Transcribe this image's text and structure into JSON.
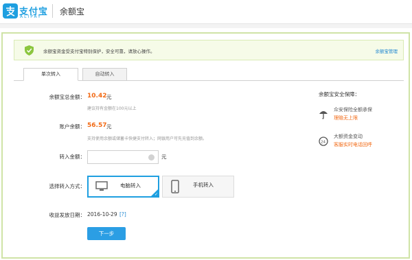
{
  "header": {
    "logo_cn": "支付宝",
    "logo_en": "ALIPAY",
    "product_title": "余额宝"
  },
  "notice": {
    "text": "余额宝资金受支付宝特别保护，安全可靠，请放心操作。",
    "link": "余额宝管理"
  },
  "tabs": [
    {
      "label": "单次转入",
      "active": true
    },
    {
      "label": "自动转入",
      "active": false
    }
  ],
  "form": {
    "total_label": "余额宝总金额：",
    "total_value": "10.42",
    "total_unit": "元",
    "total_hint": "建议持有金额在100元以上",
    "balance_label": "账户余额：",
    "balance_value": "56.57",
    "balance_unit": "元",
    "balance_hint": "支持使用余额或储蓄卡快捷支付转入；网银用户可先充值到余额。",
    "transfer_label": "转入金额：",
    "transfer_value": "",
    "transfer_unit": "元",
    "method_label": "选择转入方式：",
    "methods": [
      {
        "label": "电脑转入",
        "selected": true
      },
      {
        "label": "手机转入",
        "selected": false
      }
    ],
    "date_label": "收益发放日期：",
    "date_value": "2016-10-29",
    "date_help": "[?]",
    "next_button": "下一步"
  },
  "security": {
    "title": "余额宝安全保障：",
    "items": [
      {
        "icon": "umbrella-icon",
        "line1": "众安保险全额承保",
        "line2": "理赔无上限"
      },
      {
        "icon": "phone-24h-icon",
        "line1": "大额资金变动",
        "line2": "客服实时电话回呼"
      }
    ]
  },
  "colors": {
    "brand": "#1e9fe0",
    "accent_orange": "#f26a15",
    "frame_green": "#cfe3a6",
    "notice_bg": "#f6fbe8",
    "button_blue": "#2b9ee4"
  }
}
